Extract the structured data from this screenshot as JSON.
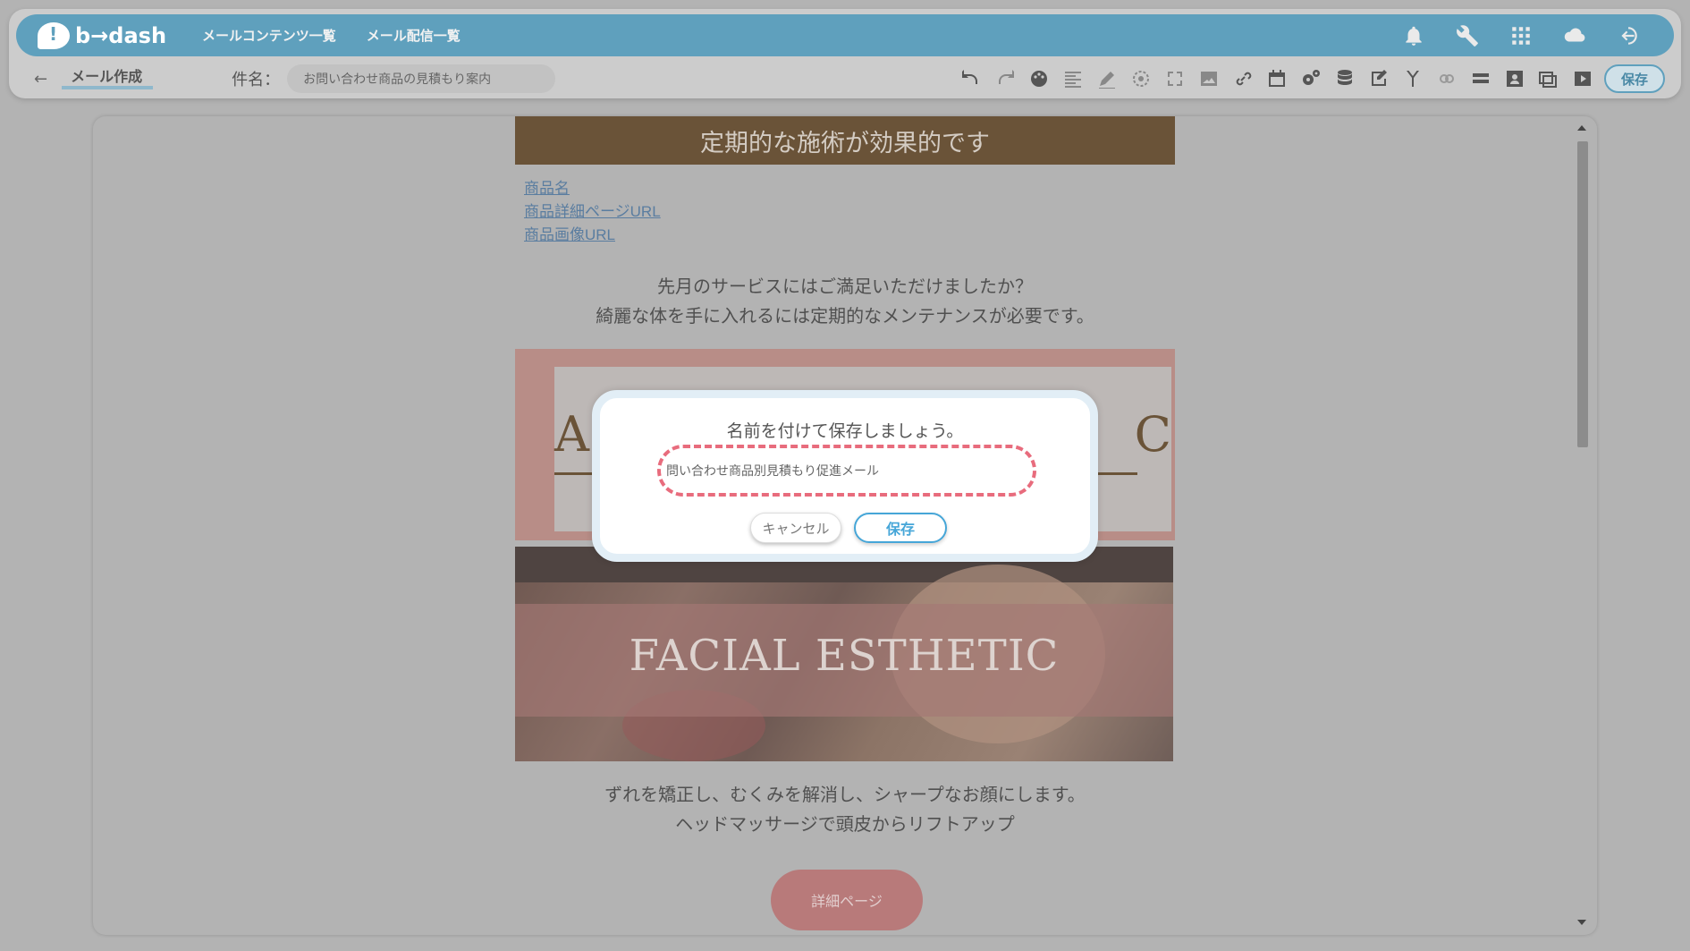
{
  "header": {
    "logo_text": "b→dash",
    "nav": [
      "メールコンテンツ一覧",
      "メール配信一覧"
    ],
    "icons": [
      "bell-icon",
      "wrench-icon",
      "grid-icon",
      "cloud-icon",
      "logout-icon"
    ]
  },
  "subbar": {
    "back_glyph": "←",
    "breadcrumb": "メール作成",
    "subject_label": "件名：",
    "subject_value": "お問い合わせ商品の見積もり案内",
    "save_label": "保存",
    "toolbar_icons": [
      "undo-icon",
      "redo-icon",
      "palette-icon",
      "align-icon",
      "pen-icon",
      "target-icon",
      "fullscreen-icon",
      "image-icon",
      "link-icon",
      "calendar-icon",
      "gears-icon",
      "database-icon",
      "edit-note-icon",
      "merge-icon",
      "link-off-icon",
      "divider-icon",
      "person-card-icon",
      "preview-icon",
      "play-icon"
    ]
  },
  "email": {
    "banner": "定期的な施術が効果的です",
    "links": [
      "商品名",
      "商品詳細ページURL",
      "商品画像URL"
    ],
    "intro_lines": [
      "先月のサービスにはご満足いただけましたか？",
      "綺麗な体を手に入れるには定期的なメンテナンスが必要です。"
    ],
    "image_letters": [
      "A",
      "C"
    ],
    "image_title": "FACIAL ESTHETIC",
    "body_lines": [
      "ずれを矯正し、むくみを解消し、シャープなお顔にします。",
      "ヘッドマッサージで頭皮からリフトアップ"
    ],
    "detail_button": "詳細ページ"
  },
  "dialog": {
    "title": "名前を付けて保存しましょう。",
    "name_value": "問い合わせ商品別見積もり促進メール",
    "cancel": "キャンセル",
    "save": "保存",
    "highlight_color": "#e86c7d"
  },
  "colors": {
    "brand": "#5fa0bd",
    "banner": "#6a5338",
    "accent_pink": "#b87a7a"
  }
}
